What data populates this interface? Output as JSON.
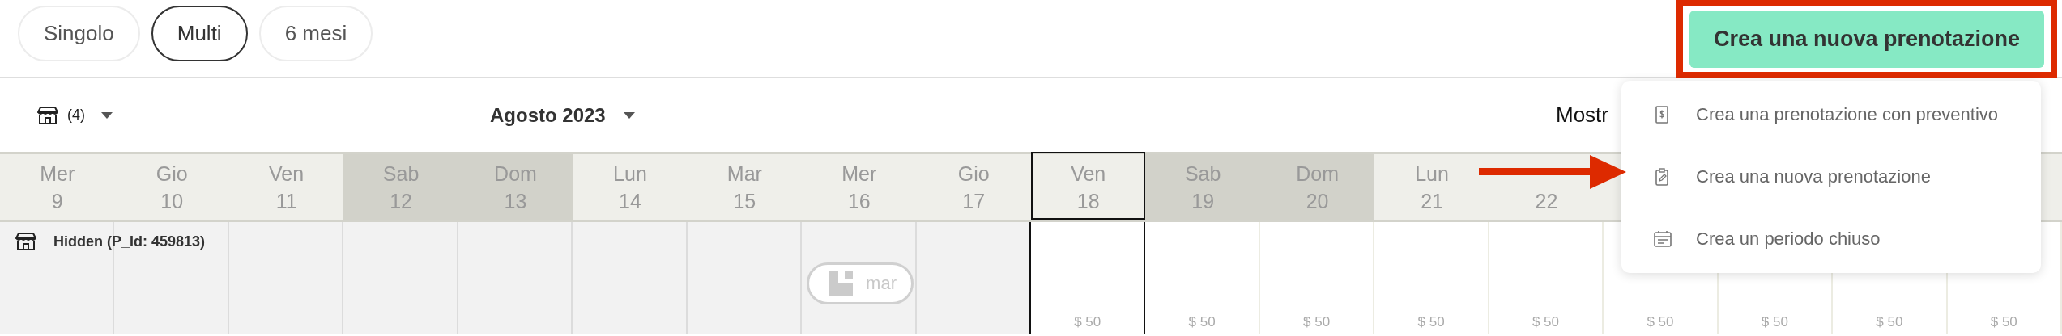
{
  "view_tabs": [
    {
      "label": "Singolo",
      "selected": false
    },
    {
      "label": "Multi",
      "selected": true
    },
    {
      "label": "6 mesi",
      "selected": false
    }
  ],
  "create_button": {
    "label": "Crea una nuova prenotazione"
  },
  "toolbar": {
    "property_count": "(4)",
    "month": "Agosto 2023",
    "show_label": "Mostr"
  },
  "calendar": {
    "days": [
      {
        "weekday": "Mer",
        "day": "9",
        "weekend": false,
        "past": true,
        "today": false
      },
      {
        "weekday": "Gio",
        "day": "10",
        "weekend": false,
        "past": true,
        "today": false
      },
      {
        "weekday": "Ven",
        "day": "11",
        "weekend": false,
        "past": true,
        "today": false
      },
      {
        "weekday": "Sab",
        "day": "12",
        "weekend": true,
        "past": true,
        "today": false
      },
      {
        "weekday": "Dom",
        "day": "13",
        "weekend": true,
        "past": true,
        "today": false
      },
      {
        "weekday": "Lun",
        "day": "14",
        "weekend": false,
        "past": true,
        "today": false
      },
      {
        "weekday": "Mar",
        "day": "15",
        "weekend": false,
        "past": true,
        "today": false
      },
      {
        "weekday": "Mer",
        "day": "16",
        "weekend": false,
        "past": true,
        "today": false
      },
      {
        "weekday": "Gio",
        "day": "17",
        "weekend": false,
        "past": true,
        "today": false
      },
      {
        "weekday": "Ven",
        "day": "18",
        "weekend": false,
        "past": false,
        "today": true,
        "price": "$ 50"
      },
      {
        "weekday": "Sab",
        "day": "19",
        "weekend": true,
        "past": false,
        "today": false,
        "price": "$ 50"
      },
      {
        "weekday": "Dom",
        "day": "20",
        "weekend": true,
        "past": false,
        "today": false,
        "price": "$ 50"
      },
      {
        "weekday": "Lun",
        "day": "21",
        "weekend": false,
        "past": false,
        "today": false,
        "price": "$ 50"
      },
      {
        "day": "22",
        "weekend": false,
        "past": false,
        "today": false,
        "price": "$ 50"
      },
      {
        "past": false,
        "today": false,
        "price": "$ 50"
      },
      {
        "past": false,
        "today": false,
        "price": "$ 50"
      },
      {
        "past": false,
        "today": false,
        "price": "$ 50"
      },
      {
        "past": false,
        "today": false,
        "price": "$ 50"
      }
    ],
    "rows": [
      {
        "name": "Hidden (P_Id: 459813)",
        "cells": [
          {},
          {},
          {},
          {},
          {},
          {},
          {},
          {
            "booking": "mar"
          },
          {},
          {},
          {},
          {},
          {},
          {},
          {},
          {},
          {},
          {}
        ]
      }
    ]
  },
  "create_menu": {
    "items": [
      {
        "kind": "quote",
        "label": "Crea una prenotazione con preventivo"
      },
      {
        "kind": "booking",
        "label": "Crea una nuova prenotazione"
      },
      {
        "kind": "closed",
        "label": "Crea un periodo chiuso"
      }
    ]
  },
  "annotations": {
    "highlight_frame": true,
    "arrow": true
  }
}
